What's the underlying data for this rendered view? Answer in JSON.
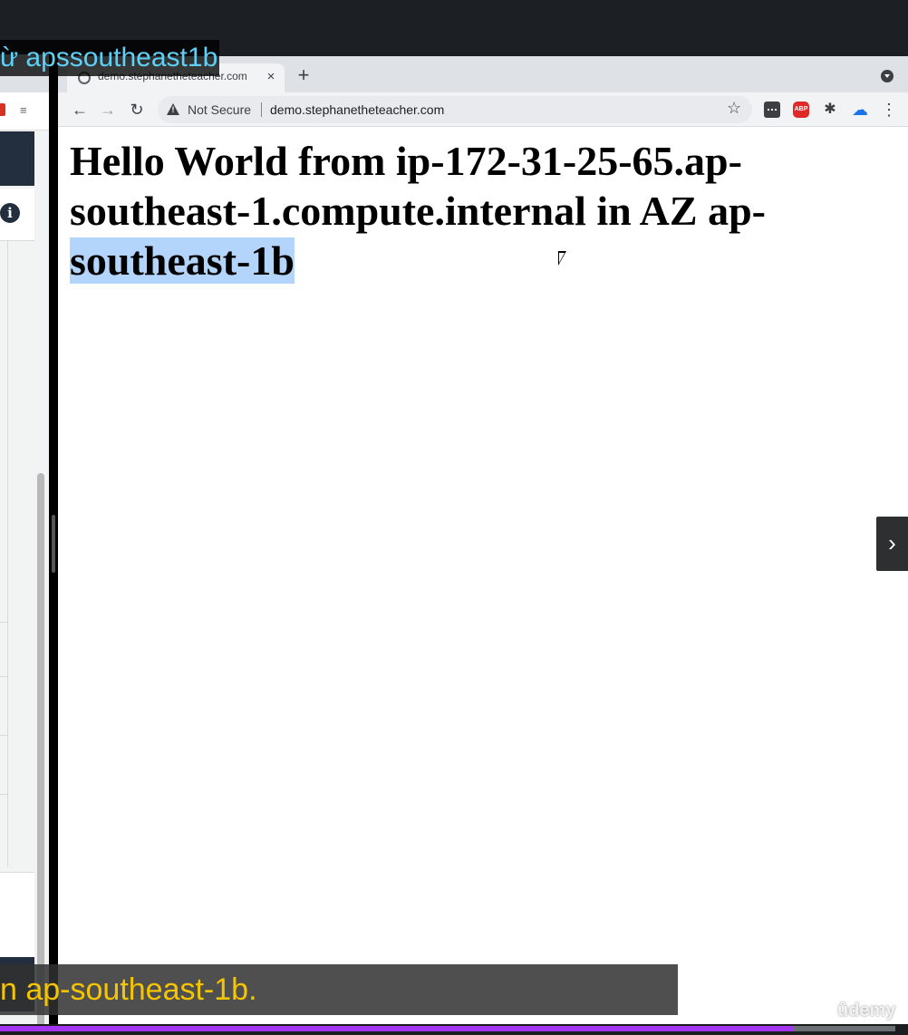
{
  "captions": {
    "top": "ừ apssoutheast1b",
    "bottom": "n ap-southeast-1b."
  },
  "browser": {
    "tab": {
      "title": "demo.stephanetheteacher.com",
      "close_icon": "×"
    },
    "new_tab_icon": "+",
    "toolbar": {
      "back_icon": "←",
      "forward_icon": "→",
      "reload_icon": "↻",
      "security_label": "Not Secure",
      "url": "demo.stephanetheteacher.com",
      "bookmark_icon": "☆",
      "adblock_label": "ABP",
      "extensions_icon": "✱",
      "cloud_icon": "☁",
      "menu_icon": "⋮"
    }
  },
  "page": {
    "heading_main": "Hello World from ip-172-31-25-65.ap-southeast-1.compute.internal in AZ ap-",
    "heading_selected": "southeast-1b"
  },
  "player": {
    "next_icon": "›",
    "watermark": "ûdemy",
    "progress_fraction": 0.887
  },
  "colors": {
    "caption_top": "#5ed0f5",
    "caption_bottom": "#f6c500",
    "selection": "#b3d4fb",
    "progress_fill": "#a435f0"
  }
}
